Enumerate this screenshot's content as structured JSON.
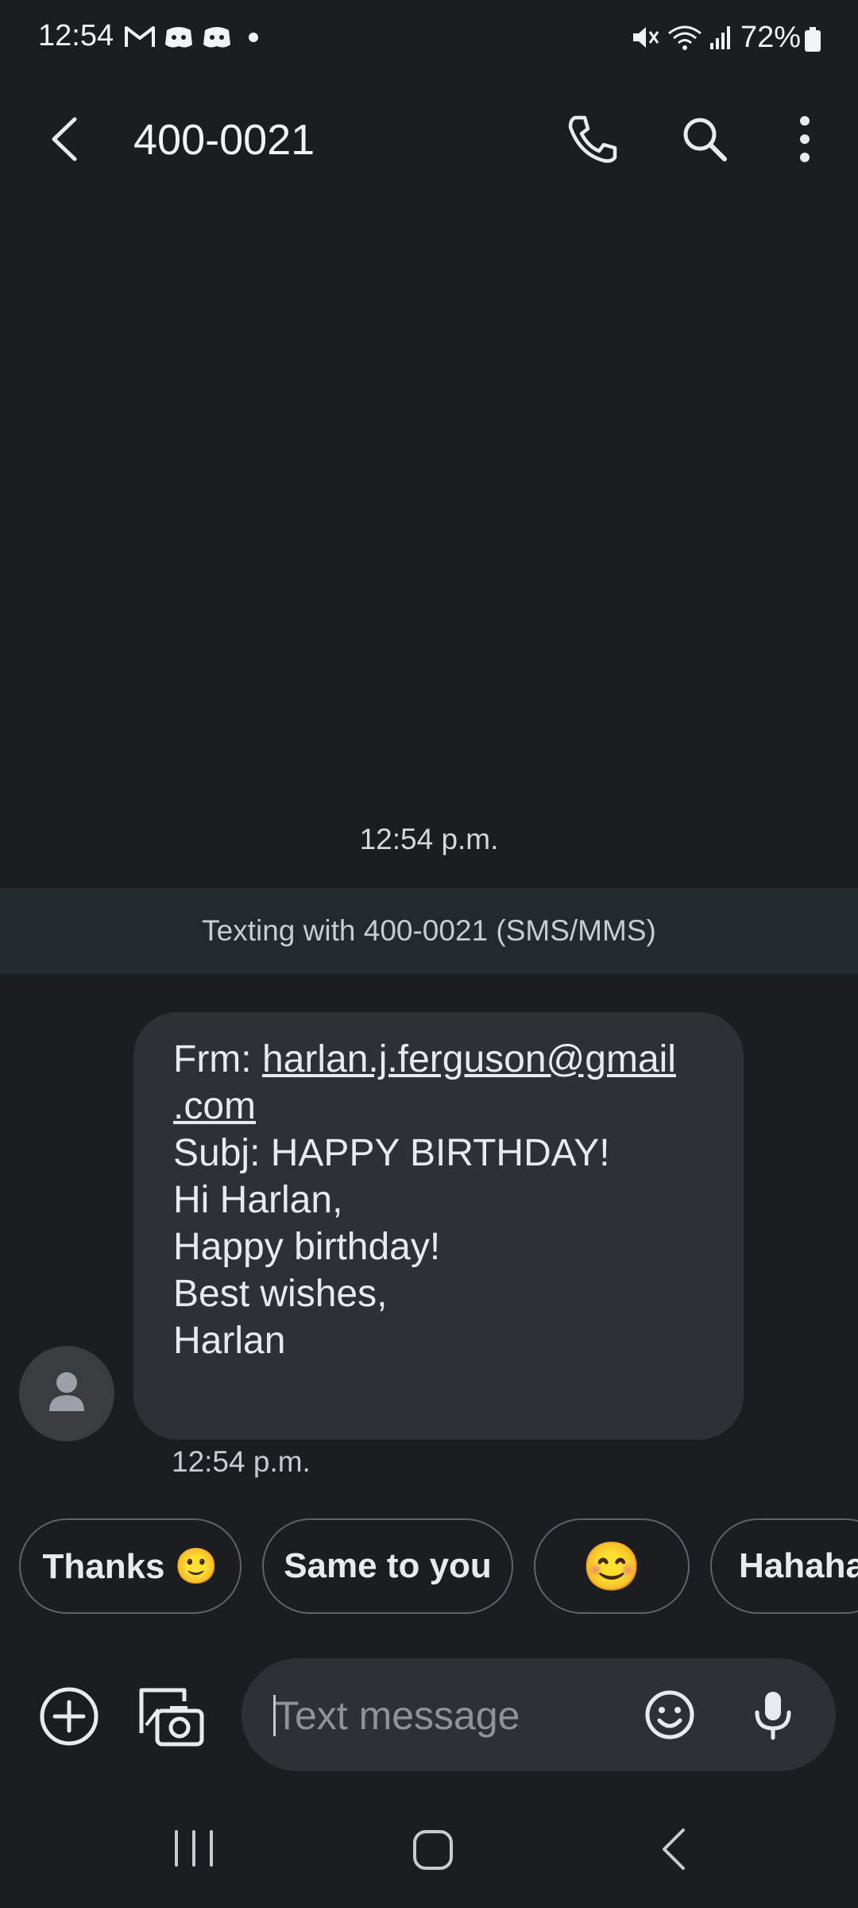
{
  "status_bar": {
    "time": "12:54",
    "battery": "72%",
    "icons": [
      "gmail-icon",
      "discord-icon",
      "discord-icon",
      "dot-icon",
      "mute-icon",
      "wifi-icon",
      "signal-icon",
      "battery-icon"
    ]
  },
  "app_bar": {
    "title": "400-0021",
    "icons": [
      "back-arrow-icon",
      "phone-icon",
      "search-icon",
      "more-vert-icon"
    ]
  },
  "conversation": {
    "date_stamp": "12:54 p.m.",
    "banner": "Texting with 400-0021 (SMS/MMS)",
    "message": {
      "from_label": "Frm: ",
      "email_part1": "harlan.j.ferguson@gmail",
      "email_part2": ".com",
      "lines": [
        "Subj: HAPPY BIRTHDAY!",
        "Hi Harlan,",
        "Happy birthday!",
        "Best wishes,",
        "Harlan"
      ],
      "time": "12:54 p.m."
    }
  },
  "quick_replies": [
    "Thanks 🙂",
    "Same to you",
    "😊",
    "Hahaha"
  ],
  "composer": {
    "placeholder": "Text message",
    "icons": [
      "add-circle-icon",
      "gallery-camera-icon",
      "emoji-icon",
      "mic-icon"
    ]
  },
  "nav_bar": {
    "icons": [
      "recents-icon",
      "home-icon",
      "back-icon"
    ]
  },
  "colors": {
    "background": "#1b1e21",
    "bubble": "#2d3034",
    "banner": "#232a2d"
  }
}
